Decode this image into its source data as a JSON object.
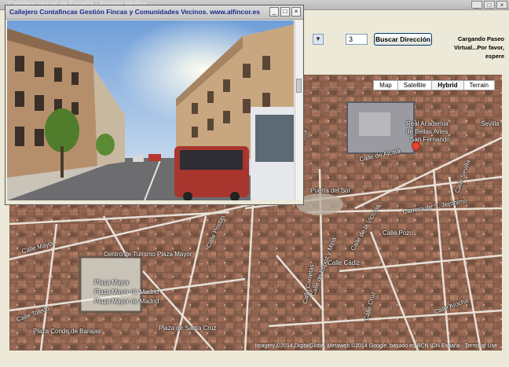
{
  "main_window": {
    "title": "Callejero Virtual de España - Agustín Muñoz",
    "minimize": "_",
    "maximize": "□",
    "close": "×"
  },
  "controls": {
    "dropdown_arrow": "▼",
    "number_value": "3",
    "search_button": "Buscar Dirección",
    "loading_lines": [
      "Cargando Paseo",
      "Virtual...Por favor,",
      "espere"
    ]
  },
  "street_view_window": {
    "title": "Callejero Contafincas Gestión Fincas y Comunidades Vecinos. www.alfincor.es",
    "minimize": "_",
    "maximize": "□",
    "close": "×"
  },
  "map": {
    "types": [
      "Map",
      "Satellite",
      "Hybrid",
      "Terrain"
    ],
    "active_type": "Hybrid",
    "labels": {
      "real_academia": "Real Academia",
      "bellas_artes": "de Bellas Artes",
      "san_fernando": "San Fernando",
      "calle_alcala": "Calle de Alcalá",
      "calle_montera": "Calle Montera",
      "calle_sevilla": "Calle Sevilla",
      "puerta_sol": "Puerta del Sol",
      "carrera_sjeronimo": "Carrera de S. Jerónimo",
      "calle_pozo": "Calle Pozo",
      "calle_cadiz": "Calle Cádiz",
      "calle_postas": "Calle Postas",
      "centro_turismo": "Centro de Turismo Plaza Mayor",
      "plaza_mayor_1": "Plaza Mayor",
      "plaza_mayor_2": "Plaza Mayor de Madrid",
      "plaza_mayor_3": "Plaza Mayor de Madrid",
      "calle_toledo": "Calle Toledo",
      "calle_mayor": "Calle Mayor",
      "calle_atocha": "Calle Atocha",
      "santa_cruz": "Plaza de Santa Cruz",
      "calle_carretas": "Calle Carretas",
      "calle_cruz": "Calle Cruz",
      "sevilla_metro": "Sevilla",
      "plaza_conde": "Plaza Conde de Barajas",
      "calle_espoz": "Calle de Espoz y Mina",
      "calle_victoria": "Calle de la Victoria"
    },
    "copyright": "Imagery ©2014 DigitalGlobe, Metaweb ©2014 Google, basado en BCN IGN España · Terms of Use"
  }
}
